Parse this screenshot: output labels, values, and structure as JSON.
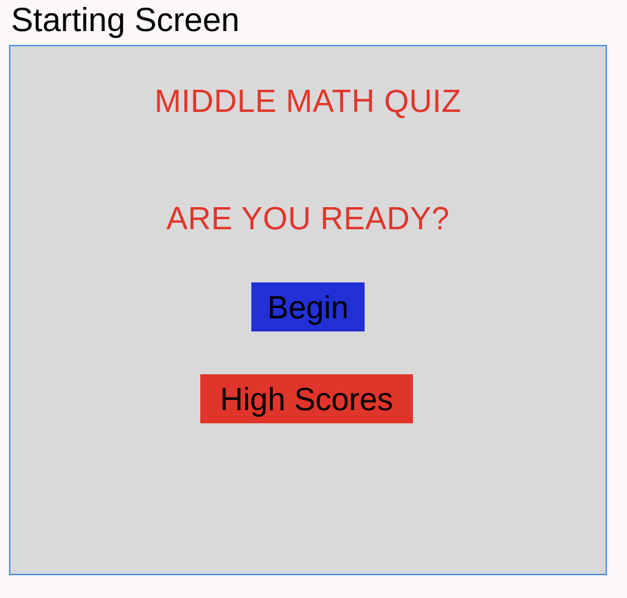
{
  "frame": {
    "label": "Starting Screen"
  },
  "quiz": {
    "title": "MIDDLE MATH QUIZ",
    "prompt": "ARE YOU READY?",
    "begin_label": "Begin",
    "high_scores_label": "High Scores"
  },
  "colors": {
    "title_text": "#e0352b",
    "begin_button": "#2230d6",
    "high_scores_button": "#e0352b",
    "panel_background": "#d9d9d9",
    "frame_border": "#4a90e2"
  }
}
